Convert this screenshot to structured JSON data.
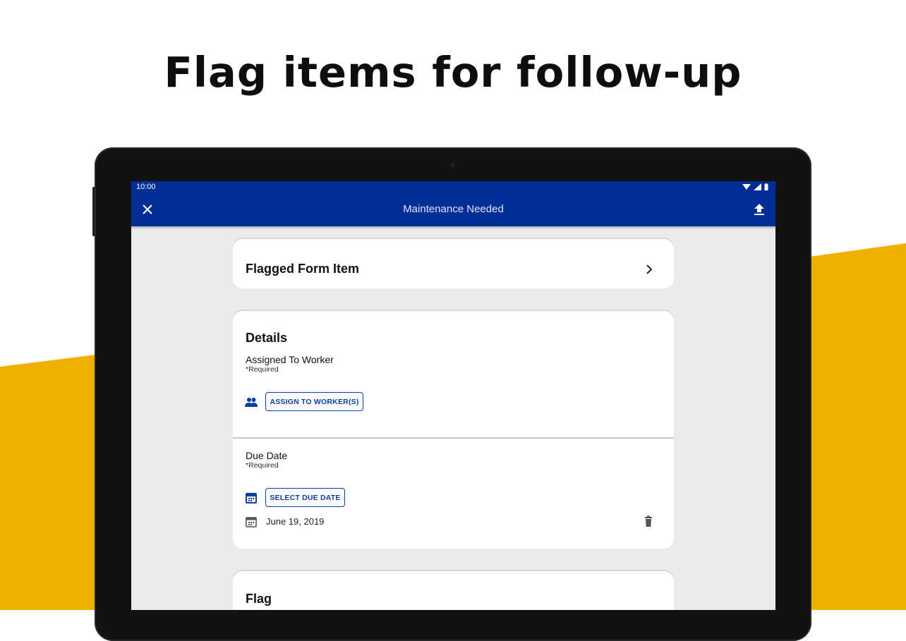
{
  "headline": "Flag items for follow-up",
  "colors": {
    "appbar": "#002d96",
    "accent": "#0a3ea8",
    "yellow": "#f0b000"
  },
  "status_bar": {
    "time": "10:00",
    "icons": [
      "wifi-icon",
      "signal-icon",
      "battery-icon"
    ]
  },
  "appbar": {
    "title": "Maintenance Needed",
    "left_icon": "close-icon",
    "right_icon": "upload-icon"
  },
  "flagged_item": {
    "title": "Flagged Form Item",
    "icon": "chevron-right-icon"
  },
  "details": {
    "heading": "Details",
    "assigned": {
      "label": "Assigned To Worker",
      "required": "*Required",
      "button": "ASSIGN TO WORKER(S)",
      "icon": "people-icon"
    },
    "due_date": {
      "label": "Due Date",
      "required": "*Required",
      "button": "SELECT DUE DATE",
      "icon": "calendar-icon",
      "value": "June 19, 2019",
      "delete_icon": "trash-icon"
    }
  },
  "flag": {
    "heading": "Flag"
  }
}
